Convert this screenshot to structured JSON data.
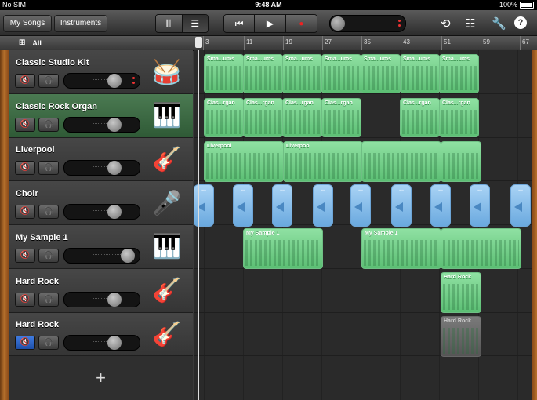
{
  "status": {
    "carrier": "No SIM",
    "time": "9:48 AM",
    "battery": "100%"
  },
  "toolbar": {
    "my_songs": "My Songs",
    "instruments": "Instruments",
    "view_keys_icon": "keyboard-icon",
    "view_tracks_icon": "tracks-list-icon"
  },
  "ruler": {
    "all": "All",
    "bars": [
      "3",
      "11",
      "19",
      "27",
      "35",
      "43",
      "51",
      "59",
      "67"
    ]
  },
  "tracks": [
    {
      "name": "Classic Studio Kit",
      "icon": "drum-kit-icon",
      "glyph": "🥁",
      "volume": 0.72,
      "muted": false,
      "selected": false
    },
    {
      "name": "Classic Rock Organ",
      "icon": "organ-icon",
      "glyph": "🎹",
      "volume": 0.72,
      "muted": false,
      "selected": true
    },
    {
      "name": "Liverpool",
      "icon": "bass-guitar-icon",
      "glyph": "🎸",
      "volume": 0.72,
      "muted": false,
      "selected": false
    },
    {
      "name": "Choir",
      "icon": "microphone-icon",
      "glyph": "🎤",
      "volume": 0.72,
      "muted": false,
      "selected": false
    },
    {
      "name": "My Sample 1",
      "icon": "keyboard-stand-icon",
      "glyph": "🎹",
      "volume": 0.95,
      "muted": false,
      "selected": false
    },
    {
      "name": "Hard Rock",
      "icon": "electric-guitar-icon",
      "glyph": "🎸",
      "volume": 0.72,
      "muted": false,
      "selected": false
    },
    {
      "name": "Hard Rock",
      "icon": "electric-guitar-icon",
      "glyph": "🎸",
      "volume": 0.72,
      "muted": true,
      "selected": false
    }
  ],
  "add_track": "+",
  "regions": {
    "drums": "Sma...ums",
    "organ": "Clas...rgan",
    "liverpool": "Liverpool",
    "sample": "My Sample 1",
    "hardrock": "Hard Rock",
    "choir": "..."
  },
  "colors": {
    "region_green": "#7fd493",
    "region_blue": "#8cc3ee",
    "selected_track": "#3f6b46",
    "mute_on": "#2f66c8"
  }
}
